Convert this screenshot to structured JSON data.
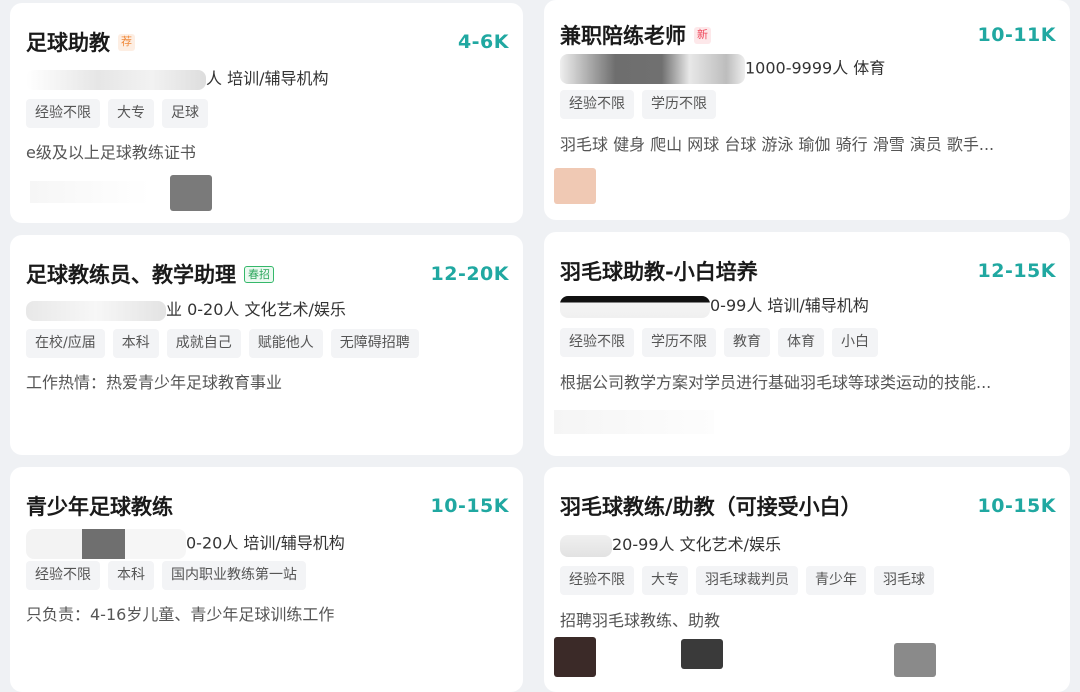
{
  "cards": [
    {
      "title": "足球助教",
      "badge": "荐",
      "salary": "4-6K",
      "company_visible": "人 培训/辅导机构",
      "tags": [
        "经验不限",
        "大专",
        "足球"
      ],
      "desc": "e级及以上足球教练证书"
    },
    {
      "title": "兼职陪练老师",
      "badge": "新",
      "salary": "10-11K",
      "company_visible": "1000-9999人 体育",
      "tags": [
        "经验不限",
        "学历不限"
      ],
      "desc": "羽毛球 健身 爬山 网球 台球 游泳 瑜伽 骑行 滑雪 演员 歌手..."
    },
    {
      "title": "足球教练员、教学助理",
      "badge": "春招",
      "salary": "12-20K",
      "company_visible": "业 0-20人 文化艺术/娱乐",
      "tags": [
        "在校/应届",
        "本科",
        "成就自己",
        "赋能他人",
        "无障碍招聘"
      ],
      "desc": "工作热情：热爱青少年足球教育事业"
    },
    {
      "title": "羽毛球助教-小白培养",
      "badge": "",
      "salary": "12-15K",
      "company_visible": "0-99人 培训/辅导机构",
      "tags": [
        "经验不限",
        "学历不限",
        "教育",
        "体育",
        "小白"
      ],
      "desc": "根据公司教学方案对学员进行基础羽毛球等球类运动的技能..."
    },
    {
      "title": "青少年足球教练",
      "badge": "",
      "salary": "10-15K",
      "company_visible": "0-20人 培训/辅导机构",
      "tags": [
        "经验不限",
        "本科",
        "国内职业教练第一站"
      ],
      "desc": "只负责：4-16岁儿童、青少年足球训练工作"
    },
    {
      "title": "羽毛球教练/助教（可接受小白）",
      "badge": "",
      "salary": "10-15K",
      "company_visible": "20-99人 文化艺术/娱乐",
      "tags": [
        "经验不限",
        "大专",
        "羽毛球裁判员",
        "青少年",
        "羽毛球"
      ],
      "desc": "招聘羽毛球教练、助教"
    }
  ],
  "colors": {
    "salary": "#20a8a1",
    "background": "#eff1f4",
    "card": "#ffffff"
  }
}
